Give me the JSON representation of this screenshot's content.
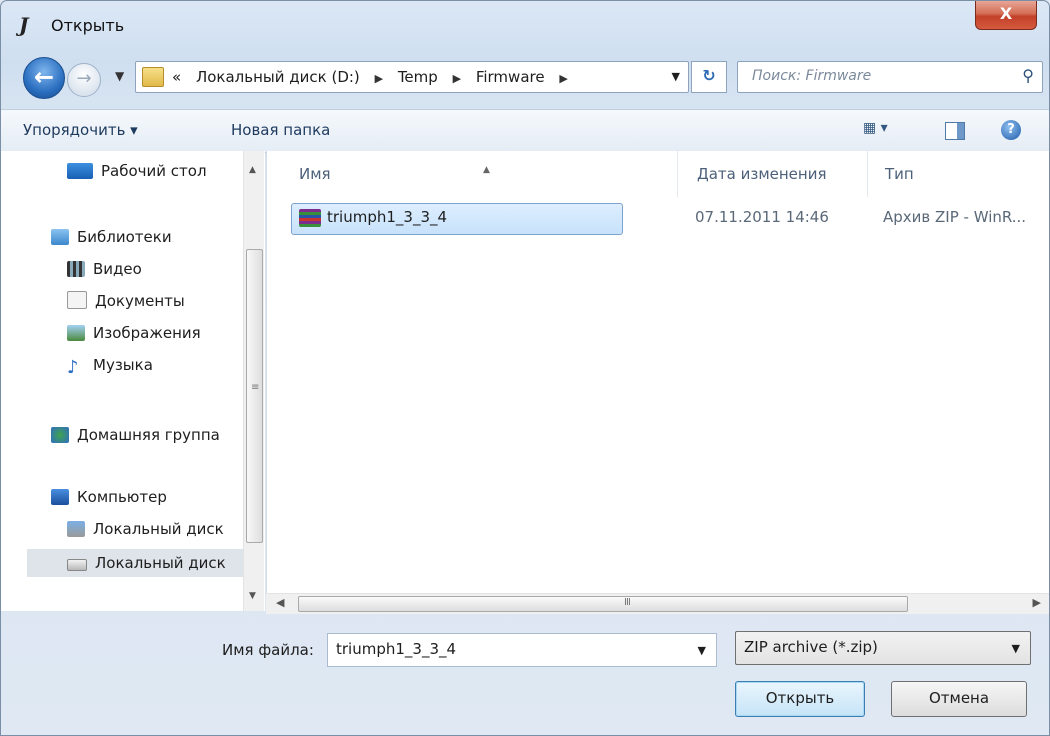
{
  "window": {
    "title": "Открыть",
    "close_label": "X"
  },
  "address": {
    "crumbs": [
      "«",
      "Локальный диск (D:)",
      "Temp",
      "Firmware"
    ],
    "search_placeholder": "Поиск: Firmware"
  },
  "toolbar": {
    "organize": "Упорядочить ▾",
    "new_folder": "Новая папка",
    "views": "▦ ▾",
    "help": "?"
  },
  "nav": {
    "items": [
      {
        "label": "Рабочий стол",
        "icon": "desktop-icon"
      },
      {
        "label": "Библиотеки",
        "icon": "libraries-icon"
      },
      {
        "label": "Видео",
        "icon": "video-icon"
      },
      {
        "label": "Документы",
        "icon": "documents-icon"
      },
      {
        "label": "Изображения",
        "icon": "pictures-icon"
      },
      {
        "label": "Музыка",
        "icon": "music-icon"
      },
      {
        "label": "Домашняя группа",
        "icon": "homegroup-icon"
      },
      {
        "label": "Компьютер",
        "icon": "computer-icon"
      },
      {
        "label": "Локальный диск",
        "icon": "system-drive-icon"
      },
      {
        "label": "Локальный диск",
        "icon": "drive-icon"
      }
    ]
  },
  "files": {
    "columns": [
      "Имя",
      "Дата изменения",
      "Тип"
    ],
    "rows": [
      {
        "name": "triumph1_3_3_4",
        "date": "07.11.2011 14:46",
        "type": "Архив ZIP - WinR..."
      }
    ]
  },
  "bottom": {
    "filename_label": "Имя файла:",
    "filename_value": "triumph1_3_3_4",
    "file_type": "ZIP archive (*.zip)",
    "open_label": "Открыть",
    "cancel_label": "Отмена"
  },
  "colors": {
    "selection": "#c8e2fb",
    "selection_border": "#7da2ce",
    "close_button": "#c2402a"
  }
}
